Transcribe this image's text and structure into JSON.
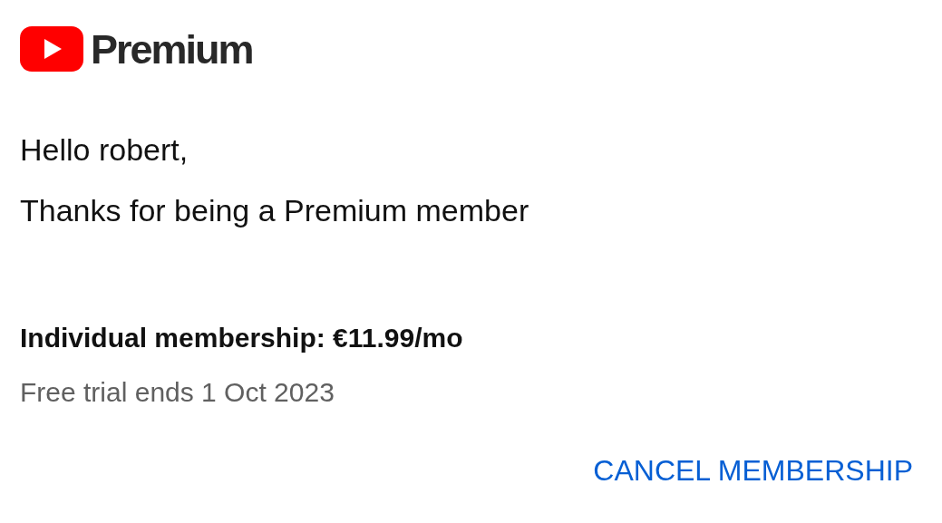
{
  "logo": {
    "wordmark": "Premium"
  },
  "greeting": "Hello robert,",
  "message": "Thanks for being a Premium member",
  "membership": {
    "plan": "Individual membership: €11.99/mo",
    "trial": "Free trial ends 1 Oct 2023"
  },
  "action": {
    "label": "CANCEL MEMBERSHIP"
  }
}
